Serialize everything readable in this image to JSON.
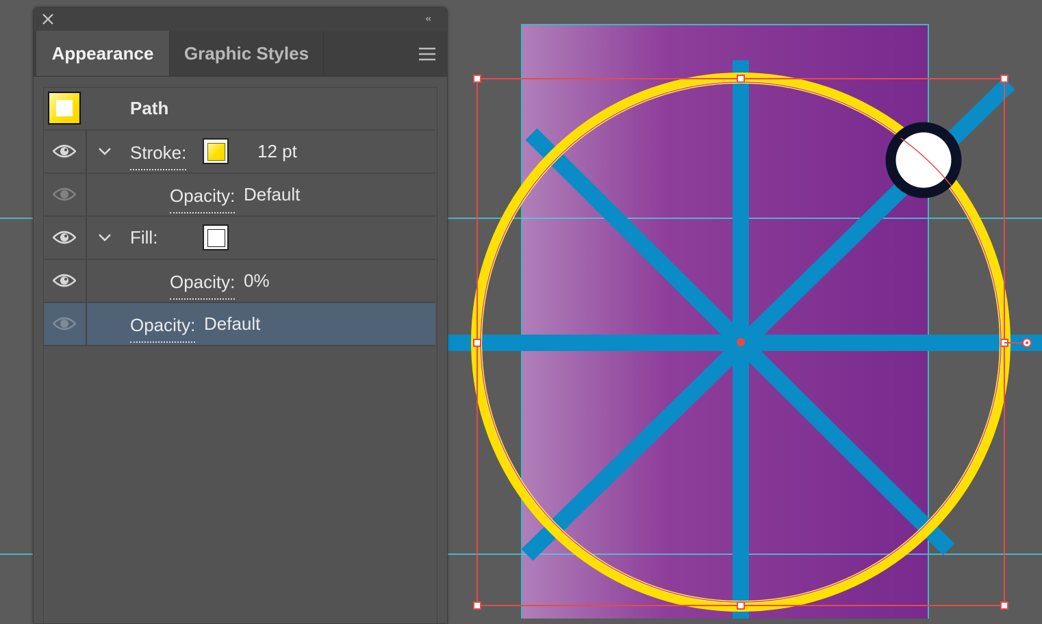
{
  "panel": {
    "close_icon": "close-icon",
    "collapse_label": "‹‹",
    "menu_icon": "hamburger-menu-icon",
    "tabs": [
      {
        "label": "Appearance",
        "active": true
      },
      {
        "label": "Graphic Styles",
        "active": false
      }
    ]
  },
  "appearance": {
    "object_title": "Path",
    "stroke": {
      "label": "Stroke:",
      "weight": "12 pt",
      "opacity_label": "Opacity:",
      "opacity_value": "Default"
    },
    "fill": {
      "label": "Fill:",
      "opacity_label": "Opacity:",
      "opacity_value": "0%"
    },
    "object_opacity": {
      "label": "Opacity:",
      "value": "Default"
    }
  },
  "colors": {
    "stroke_yellow": "#ffe000",
    "spoke_blue": "#0a8cc6",
    "artboard_purple": "#7b2a8f",
    "selection_red": "#e84a4a",
    "guide_cyan": "#45d6e6",
    "selected_row": "#4f6276"
  }
}
